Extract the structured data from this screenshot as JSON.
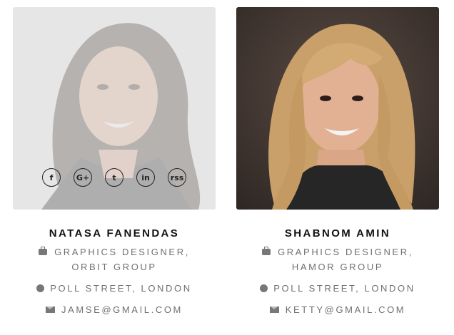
{
  "members": [
    {
      "name": "NATASA FANENDAS",
      "role": "GRAPHICS DESIGNER, ORBIT GROUP",
      "location": "POLL STREET, LONDON",
      "email": "JAMSE@GMAIL.COM",
      "photo_icon": "portrait-photo",
      "social": [
        "f",
        "G+",
        "t",
        "in",
        "rss"
      ]
    },
    {
      "name": "SHABNOM AMIN",
      "role": "GRAPHICS DESIGNER, HAMOR GROUP",
      "location": "POLL STREET, LONDON",
      "email": "KETTY@GMAIL.COM",
      "photo_icon": "portrait-photo"
    }
  ],
  "icons": {
    "role": "briefcase-icon",
    "location": "globe-icon",
    "email": "envelope-icon"
  },
  "colors": {
    "text": "#707070",
    "name": "#111111",
    "overlay": "#e6e6e6"
  }
}
